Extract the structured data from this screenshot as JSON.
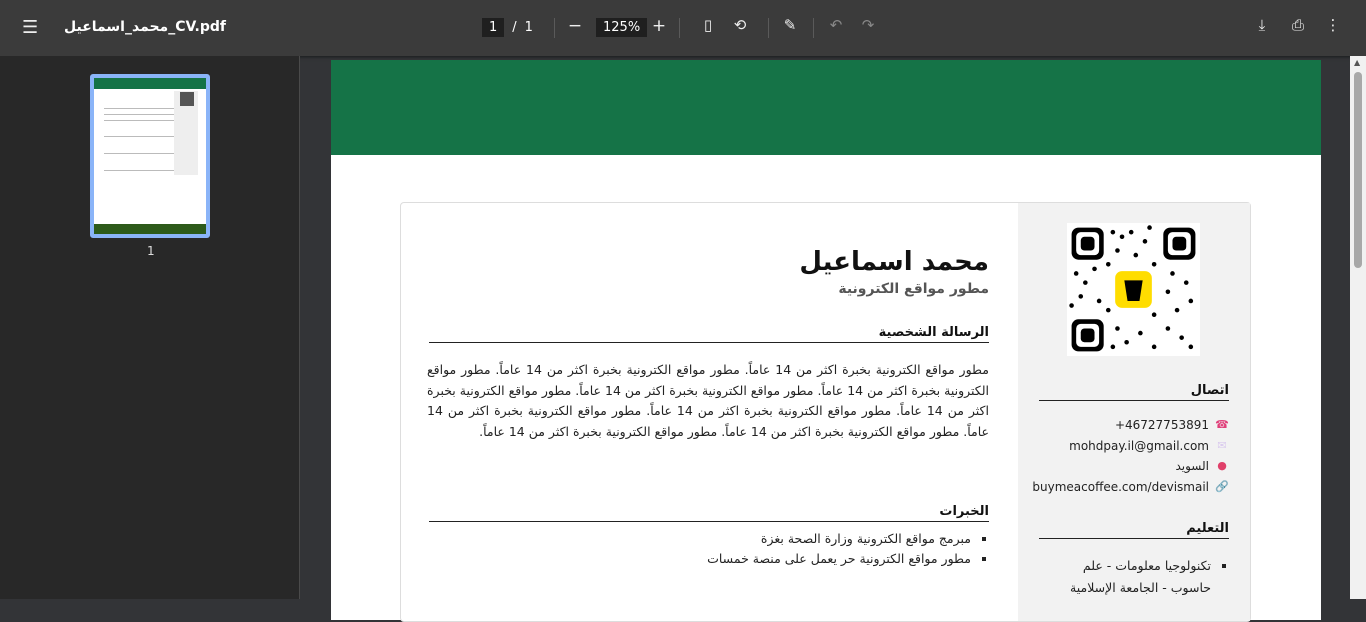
{
  "toolbar": {
    "title": "محمد_اسماعيل_CV.pdf",
    "page_current": "1",
    "page_sep": "/",
    "page_total": "1",
    "zoom": "125%"
  },
  "sidebar": {
    "thumb_label": "1"
  },
  "cv": {
    "name": "محمد اسماعيل",
    "role": "مطور مواقع الكترونية",
    "summary_title": "الرسالة الشخصية",
    "summary": "مطور مواقع الكترونية بخبرة اكثر من 14 عاماً. مطور مواقع الكترونية بخبرة اكثر من 14 عاماً. مطور مواقع الكترونية بخبرة اكثر من 14 عاماً. مطور مواقع الكترونية بخبرة اكثر من 14 عاماً. مطور مواقع الكترونية بخبرة اكثر من 14 عاماً. مطور مواقع الكترونية بخبرة اكثر من 14 عاماً. مطور مواقع الكترونية بخبرة اكثر من 14 عاماً. مطور مواقع الكترونية بخبرة اكثر من 14 عاماً. مطور مواقع الكترونية بخبرة اكثر من 14 عاماً.",
    "experience_title": "الخبرات",
    "experience": [
      "مبرمج مواقع الكترونية وزارة الصحة بغزة",
      "مطور مواقع الكترونية حر يعمل على منصة خمسات"
    ],
    "contact_title": "اتصال",
    "phone": "+46727753891",
    "email": "mohdpay.il@gmail.com",
    "location": "السويد",
    "link": "buymeacoffee.com/devismail",
    "education_title": "التعليم",
    "education": [
      "تكنولوجيا معلومات - علم حاسوب - الجامعة الإسلامية"
    ]
  },
  "colors": {
    "header": "#157347",
    "accent": "#8ab4f8"
  }
}
